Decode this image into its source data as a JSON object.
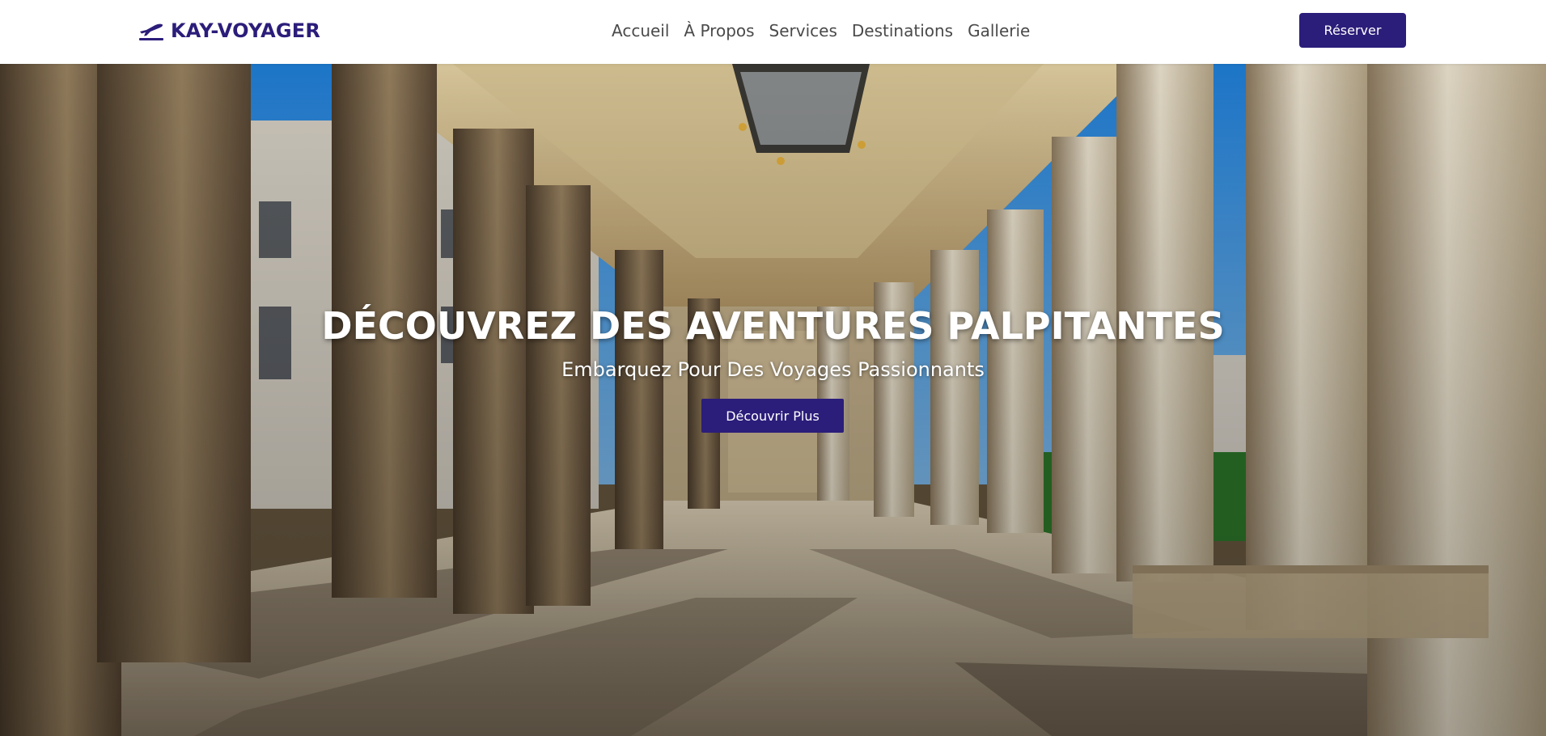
{
  "brand": {
    "name": "KAY-VOYAGER",
    "icon": "plane-takeoff-icon",
    "color": "#2b1d7a"
  },
  "nav": {
    "links": [
      {
        "label": "Accueil"
      },
      {
        "label": "À Propos"
      },
      {
        "label": "Services"
      },
      {
        "label": "Destinations"
      },
      {
        "label": "Gallerie"
      }
    ],
    "cta_label": "Réserver"
  },
  "hero": {
    "title": "DÉCOUVREZ DES AVENTURES PALPITANTES",
    "subtitle": "Embarquez Pour Des Voyages Passionnants",
    "cta_label": "Découvrir Plus",
    "background": "colonnade-photo"
  },
  "colors": {
    "accent": "#2b1d7a",
    "nav_text": "#4a4a4a",
    "hero_text": "#ffffff"
  }
}
